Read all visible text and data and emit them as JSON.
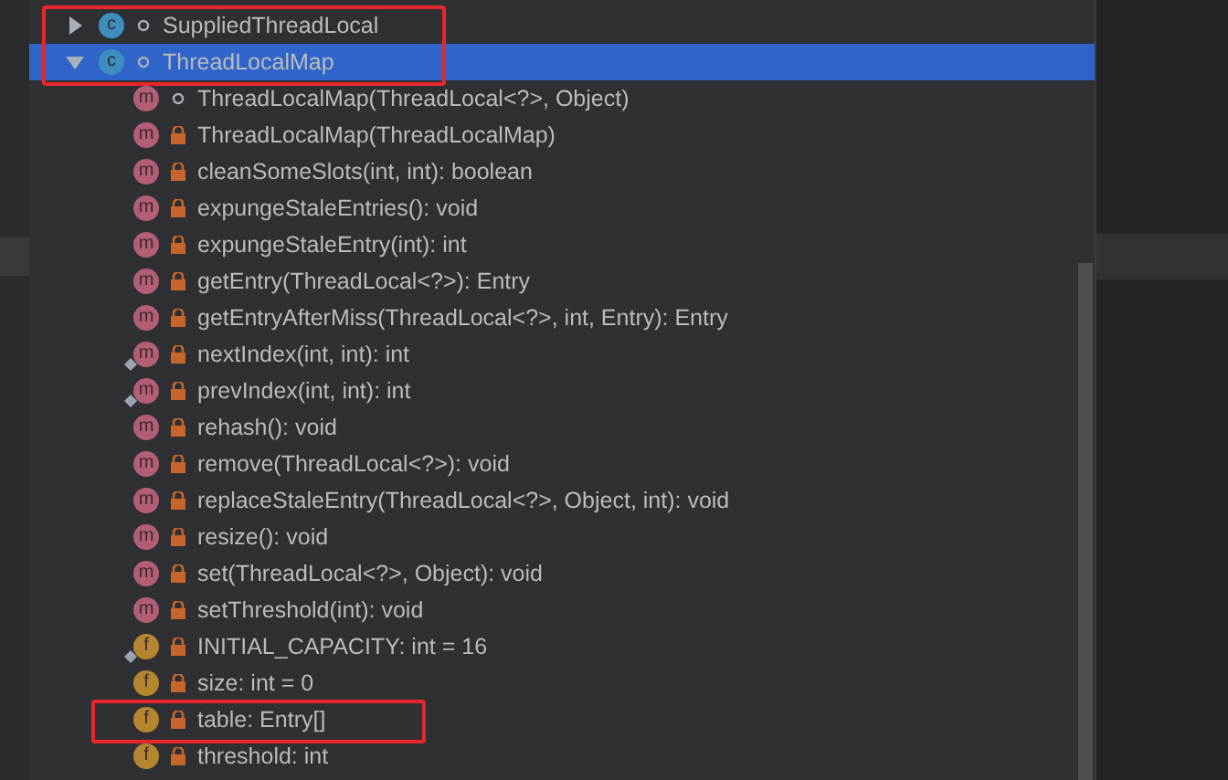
{
  "tree": [
    {
      "name": "SuppliedThreadLocal",
      "kind": "class",
      "badge": "c",
      "private": false,
      "expanded": false,
      "selected": false,
      "highlighted": true
    },
    {
      "name": "ThreadLocalMap",
      "kind": "class",
      "badge": "c",
      "private": false,
      "expanded": true,
      "selected": true,
      "highlighted": true,
      "children": [
        {
          "name": "ThreadLocalMap(ThreadLocal<?>, Object)",
          "kind": "method",
          "badge": "m",
          "private": false,
          "selected": false
        },
        {
          "name": "ThreadLocalMap(ThreadLocalMap)",
          "kind": "method",
          "badge": "m",
          "private": true,
          "selected": false
        },
        {
          "name": "cleanSomeSlots(int, int): boolean",
          "kind": "method",
          "badge": "m",
          "private": true,
          "selected": false
        },
        {
          "name": "expungeStaleEntries(): void",
          "kind": "method",
          "badge": "m",
          "private": true,
          "selected": false
        },
        {
          "name": "expungeStaleEntry(int): int",
          "kind": "method",
          "badge": "m",
          "private": true,
          "selected": false
        },
        {
          "name": "getEntry(ThreadLocal<?>): Entry",
          "kind": "method",
          "badge": "m",
          "private": true,
          "selected": false
        },
        {
          "name": "getEntryAfterMiss(ThreadLocal<?>, int, Entry): Entry",
          "kind": "method",
          "badge": "m",
          "private": true,
          "selected": false
        },
        {
          "name": "nextIndex(int, int): int",
          "kind": "method",
          "badge": "m",
          "private": true,
          "static": true,
          "selected": false
        },
        {
          "name": "prevIndex(int, int): int",
          "kind": "method",
          "badge": "m",
          "private": true,
          "static": true,
          "selected": false
        },
        {
          "name": "rehash(): void",
          "kind": "method",
          "badge": "m",
          "private": true,
          "selected": false
        },
        {
          "name": "remove(ThreadLocal<?>): void",
          "kind": "method",
          "badge": "m",
          "private": true,
          "selected": false
        },
        {
          "name": "replaceStaleEntry(ThreadLocal<?>, Object, int): void",
          "kind": "method",
          "badge": "m",
          "private": true,
          "selected": false
        },
        {
          "name": "resize(): void",
          "kind": "method",
          "badge": "m",
          "private": true,
          "selected": false
        },
        {
          "name": "set(ThreadLocal<?>, Object): void",
          "kind": "method",
          "badge": "m",
          "private": true,
          "selected": false
        },
        {
          "name": "setThreshold(int): void",
          "kind": "method",
          "badge": "m",
          "private": true,
          "selected": false
        },
        {
          "name": "INITIAL_CAPACITY: int = 16",
          "kind": "field",
          "badge": "f",
          "private": true,
          "static": true,
          "selected": false
        },
        {
          "name": "size: int = 0",
          "kind": "field",
          "badge": "f",
          "private": true,
          "selected": false
        },
        {
          "name": "table: Entry[]",
          "kind": "field",
          "badge": "f",
          "private": true,
          "selected": false,
          "highlighted": true
        },
        {
          "name": "threshold: int",
          "kind": "field",
          "badge": "f",
          "private": true,
          "selected": false
        }
      ]
    }
  ]
}
